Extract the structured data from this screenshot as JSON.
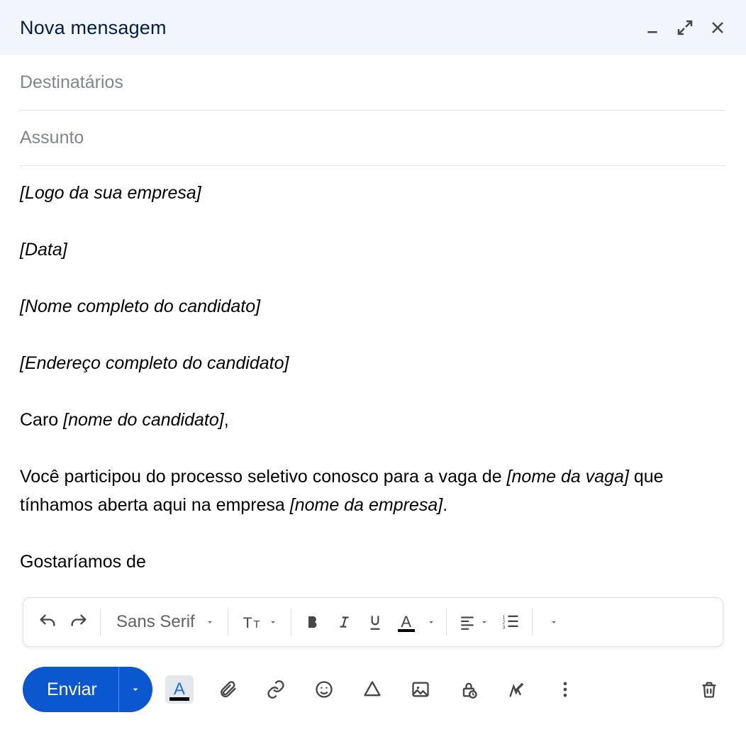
{
  "header": {
    "title": "Nova mensagem"
  },
  "fields": {
    "recipients_placeholder": "Destinatários",
    "recipients_value": "",
    "subject_placeholder": "Assunto",
    "subject_value": ""
  },
  "body": {
    "lines": {
      "l1_italic": "[Logo da sua empresa]",
      "l2_italic": "[Data]",
      "l3_italic": "[Nome completo do candidato]",
      "l4_italic": "[Endereço completo do candidato]",
      "l5_part1": "Caro ",
      "l5_italic": "[nome do candidato]",
      "l5_part2": ",",
      "l6_part1": "Você participou do processo seletivo conosco para a vaga de ",
      "l6_italic1": "[nome da vaga]",
      "l6_part2": " que tínhamos aberta aqui na empresa ",
      "l6_italic2": "[nome da empresa]",
      "l6_part3": ".",
      "l7": "Gostaríamos de"
    }
  },
  "format_toolbar": {
    "font_label": "Sans Serif"
  },
  "actions": {
    "send_label": "Enviar"
  },
  "colors": {
    "send_button_bg": "#0b57d0",
    "title_color": "#041e49",
    "ink_blue": "#1a73e8"
  }
}
